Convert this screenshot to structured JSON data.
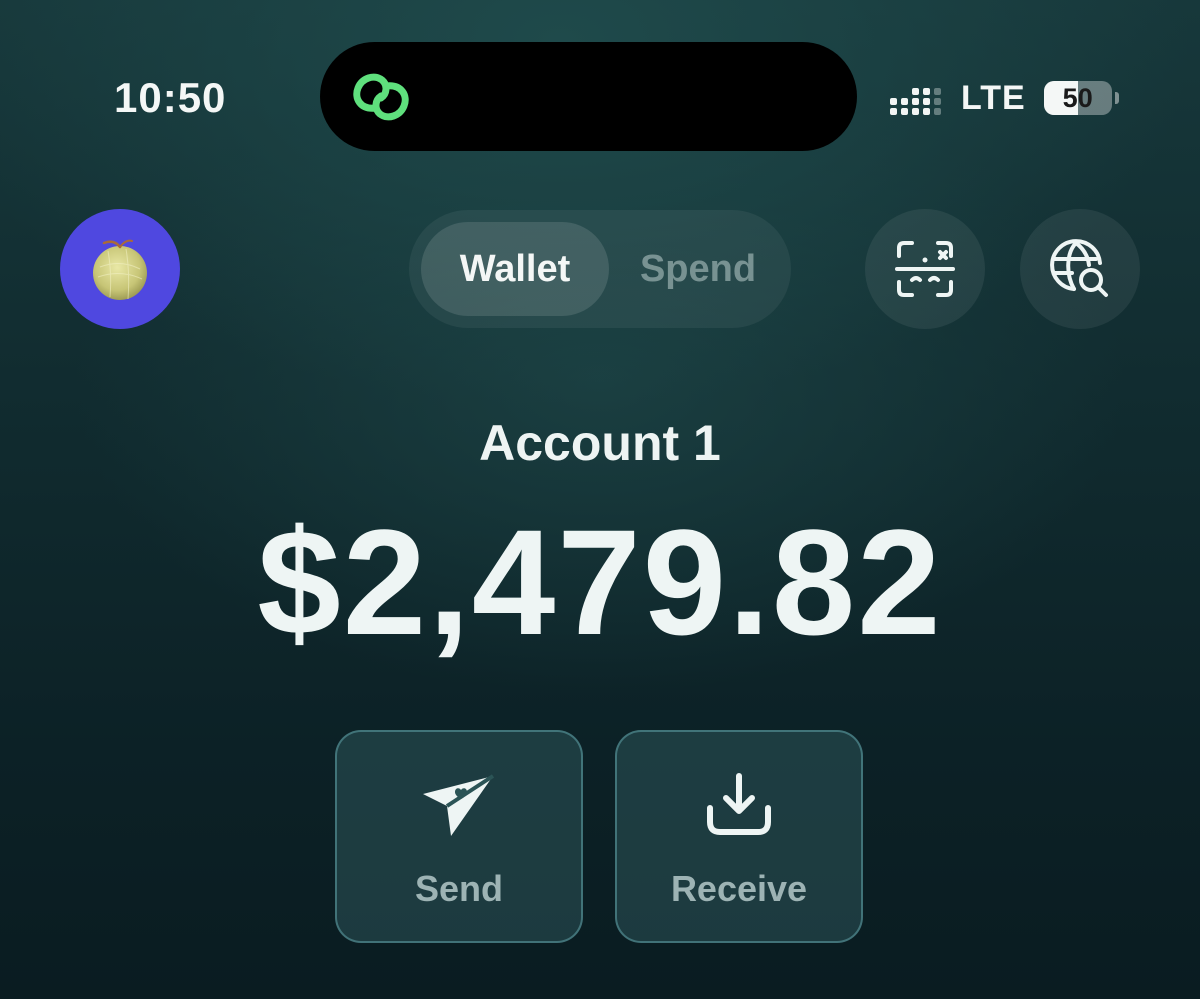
{
  "status_bar": {
    "time": "10:50",
    "network": "LTE",
    "battery_level": "50",
    "battery_fraction": 0.5,
    "island_icon": "link-rings-icon",
    "island_icon_color": "#5fe07d"
  },
  "header": {
    "avatar_icon": "melon-avatar-icon",
    "avatar_color": "#4f48e0",
    "mode_toggle": {
      "wallet_label": "Wallet",
      "spend_label": "Spend",
      "selected": "Wallet"
    },
    "scan_icon": "scan-icon",
    "browse_icon": "globe-search-icon"
  },
  "account": {
    "name": "Account 1",
    "balance": "$2,479.82"
  },
  "actions": {
    "send_label": "Send",
    "send_icon": "paper-plane-heart-icon",
    "receive_label": "Receive",
    "receive_icon": "download-tray-icon"
  }
}
